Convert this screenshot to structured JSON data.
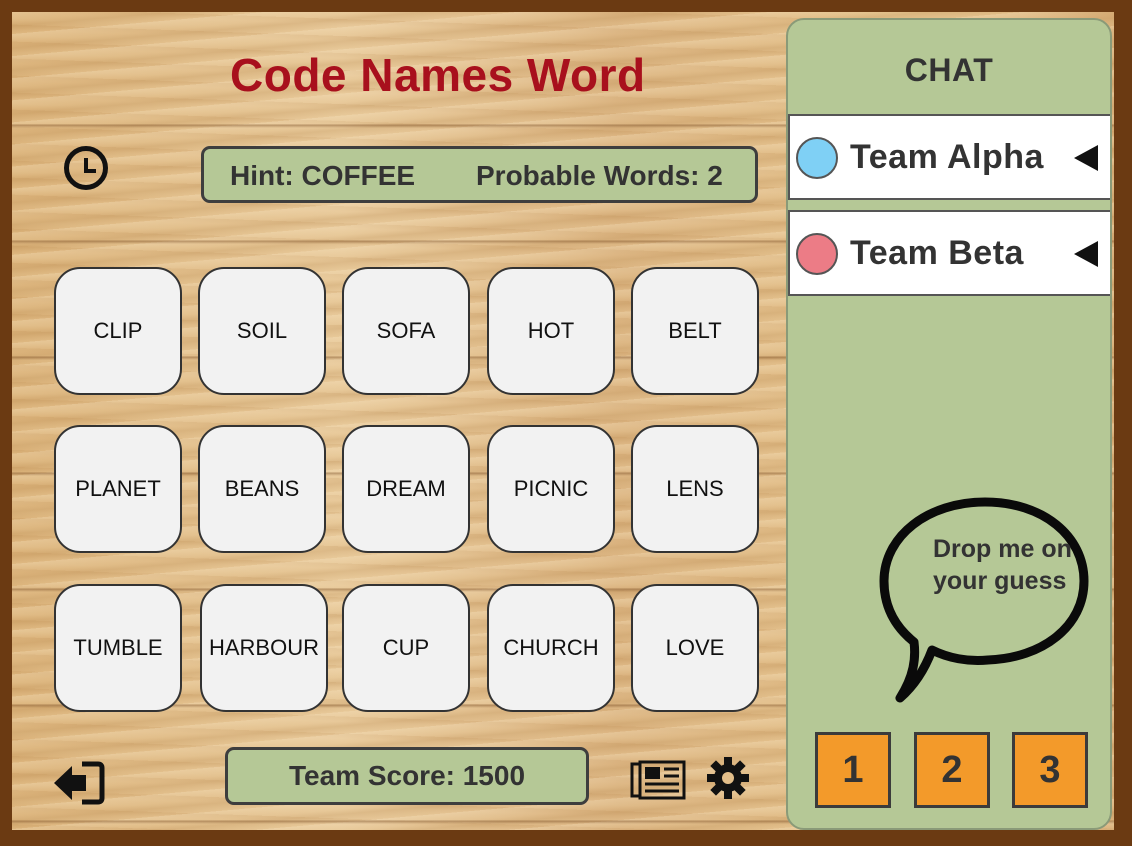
{
  "title": "Code Names Word",
  "hint": {
    "label": "Hint: COFFEE",
    "probable_label": "Probable Words: 2"
  },
  "cards": [
    "CLIP",
    "SOIL",
    "SOFA",
    "HOT",
    "BELT",
    "PLANET",
    "BEANS",
    "DREAM",
    "PICNIC",
    "LENS",
    "TUMBLE",
    "HARBOUR",
    "CUP",
    "CHURCH",
    "LOVE"
  ],
  "score": {
    "label": "Team Score: 1500"
  },
  "chat": {
    "title": "CHAT",
    "teams": [
      {
        "name": "Team Alpha",
        "color": "#7fd0f5"
      },
      {
        "name": "Team Beta",
        "color": "#ec7c86"
      }
    ]
  },
  "guess_bubble": "Drop me on your guess",
  "guess_buttons": [
    "1",
    "2",
    "3"
  ],
  "colors": {
    "title": "#a8101d",
    "panel": "#b5c896",
    "button": "#f39a2a",
    "card": "#f2f2f2"
  },
  "icons": [
    "clock-icon",
    "exit-icon",
    "newspaper-icon",
    "gear-icon",
    "speech-bubble-icon",
    "triangle-left-icon"
  ]
}
